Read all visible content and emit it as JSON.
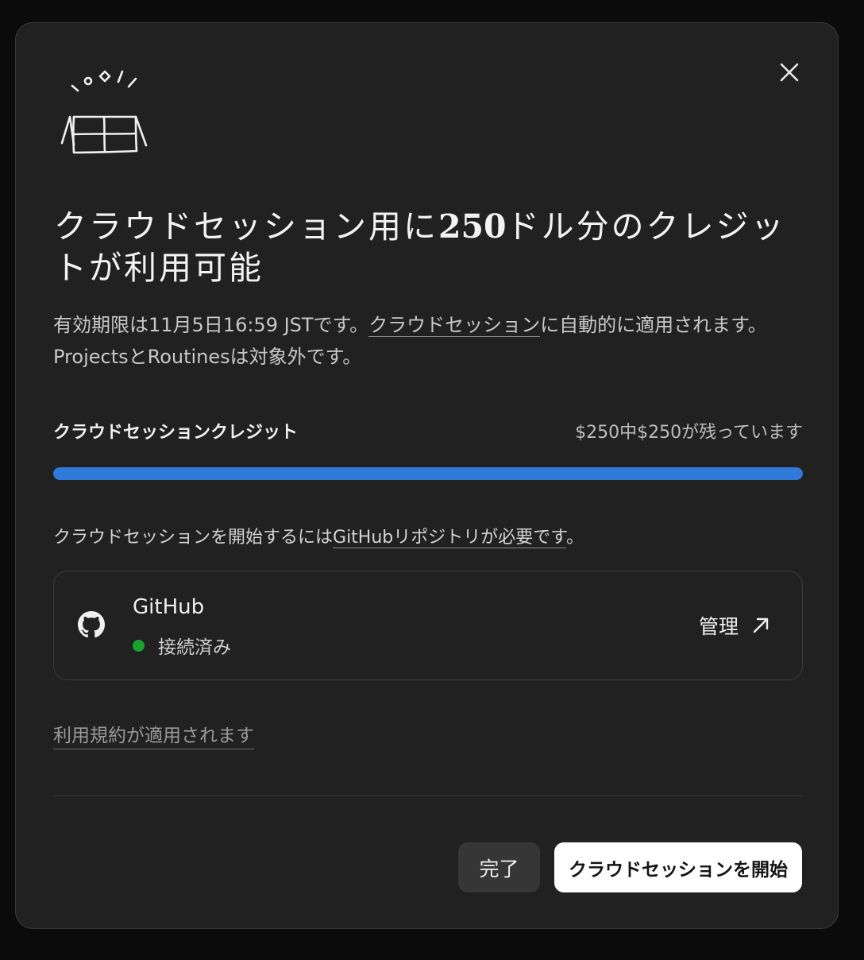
{
  "dialog": {
    "title_prefix": "クラウドセッション用に",
    "title_amount": "250",
    "title_suffix": "ドル分のクレジットが利用可能",
    "desc_line1_before": "有効期限は11月5日16:59 JSTです。",
    "desc_link": "クラウドセッション",
    "desc_line1_after": "に自動的に適用されます。",
    "desc_line2": "ProjectsとRoutinesは対象外です。"
  },
  "credits": {
    "label": "クラウドセッションクレジット",
    "remaining_text": "$250中$250が残っています",
    "progress_fraction": 1.0,
    "bar_color": "#2f7ad9"
  },
  "repo_note": {
    "before": "クラウドセッションを開始するには",
    "link": "GitHubリポジトリが必要です",
    "after": "。"
  },
  "github": {
    "name": "GitHub",
    "status": "接続済み",
    "status_color": "#1aa32c",
    "manage_label": "管理",
    "icon": "github-icon"
  },
  "terms_link": "利用規約が適用されます",
  "buttons": {
    "done": "完了",
    "start": "クラウドセッションを開始"
  },
  "icons": {
    "close": "close-icon",
    "gift": "gift-box-icon",
    "external": "arrow-up-right-icon"
  }
}
